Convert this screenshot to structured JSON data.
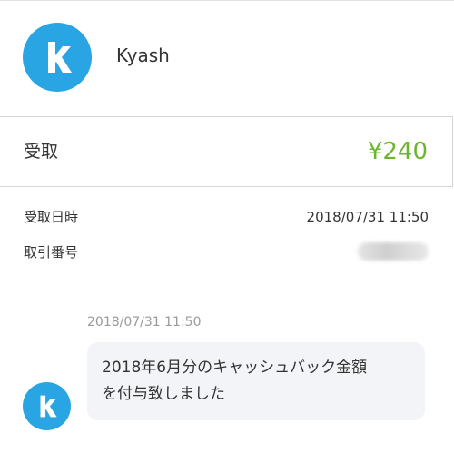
{
  "sender": {
    "name": "Kyash",
    "avatar_icon": "kyash-logo-icon",
    "avatar_color": "#2aa5e3"
  },
  "transaction": {
    "type_label": "受取",
    "amount": "¥240",
    "amount_color": "#6cb52d"
  },
  "details": [
    {
      "label": "受取日時",
      "value": "2018/07/31 11:50"
    },
    {
      "label": "取引番号",
      "value": ""
    }
  ],
  "message": {
    "timestamp": "2018/07/31 11:50",
    "lines": [
      "2018年6月分のキャッシュバック金額",
      "を付与致しました"
    ]
  }
}
